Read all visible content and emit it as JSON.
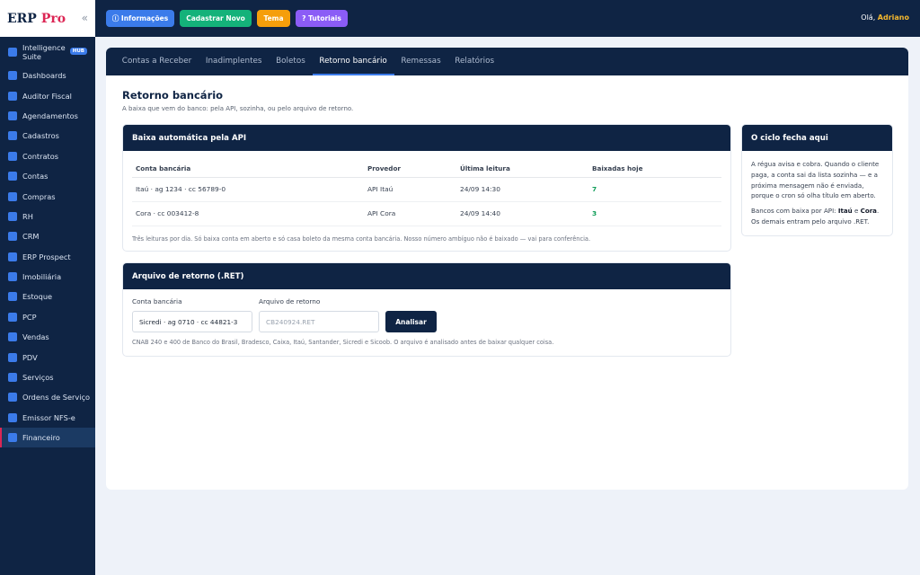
{
  "brand": {
    "erp": "ERP",
    "pro": "Pro",
    "collapse_icon": "«"
  },
  "sidebar": {
    "items": [
      {
        "label": "Intelligence Suite",
        "badge": "HUB"
      },
      {
        "label": "Dashboards"
      },
      {
        "label": "Auditor Fiscal"
      },
      {
        "label": "Agendamentos"
      },
      {
        "label": "Cadastros"
      },
      {
        "label": "Contratos"
      },
      {
        "label": "Contas"
      },
      {
        "label": "Compras"
      },
      {
        "label": "RH"
      },
      {
        "label": "CRM"
      },
      {
        "label": "ERP Prospect"
      },
      {
        "label": "Imobiliária"
      },
      {
        "label": "Estoque"
      },
      {
        "label": "PCP"
      },
      {
        "label": "Vendas"
      },
      {
        "label": "PDV"
      },
      {
        "label": "Serviços"
      },
      {
        "label": "Ordens de Serviço"
      },
      {
        "label": "Emissor NFS-e"
      },
      {
        "label": "Financeiro",
        "active": true
      }
    ]
  },
  "topbar": {
    "buttons": [
      {
        "label": "ⓘ Informações",
        "color": "#3b7bea"
      },
      {
        "label": "Cadastrar Novo",
        "color": "#14b27a"
      },
      {
        "label": "Tema",
        "color": "#f59e0b"
      },
      {
        "label": "? Tutoriais",
        "color": "#8b5cf6"
      }
    ],
    "greeting_prefix": "Olá,",
    "user_name": "Adriano"
  },
  "tabs": [
    {
      "label": "Contas a Receber"
    },
    {
      "label": "Inadimplentes"
    },
    {
      "label": "Boletos"
    },
    {
      "label": "Retorno bancário",
      "active": true
    },
    {
      "label": "Remessas"
    },
    {
      "label": "Relatórios"
    }
  ],
  "page": {
    "title": "Retorno bancário",
    "subtitle": "A baixa que vem do banco: pela API, sozinha, ou pelo arquivo de retorno."
  },
  "api_panel": {
    "title": "Baixa automática pela API",
    "columns": [
      "Conta bancária",
      "Provedor",
      "Última leitura",
      "Baixadas hoje"
    ],
    "rows": [
      [
        "Itaú · ag 1234 · cc 56789-0",
        "API Itaú",
        "24/09 14:30",
        "7"
      ],
      [
        "Cora · cc 003412-8",
        "API Cora",
        "24/09 14:40",
        "3"
      ]
    ],
    "note": "Três leituras por dia. Só baixa conta em aberto e só casa boleto da mesma conta bancária. Nosso número ambíguo não é baixado — vai para conferência."
  },
  "ret_panel": {
    "title": "Arquivo de retorno (.RET)",
    "account_label": "Conta bancária",
    "account_value": "Sicredi · ag 0710 · cc 44821-3",
    "file_label": "Arquivo de retorno",
    "file_placeholder": "CB240924.RET",
    "analyze_label": "Analisar",
    "note": "CNAB 240 e 400 de Banco do Brasil, Bradesco, Caixa, Itaú, Santander, Sicredi e Sicoob. O arquivo é analisado antes de baixar qualquer coisa."
  },
  "side_panel": {
    "title": "O ciclo fecha aqui",
    "paragraph1": "A régua avisa e cobra. Quando o cliente paga, a conta sai da lista sozinha — e a próxima mensagem não é enviada, porque o cron só olha título em aberto.",
    "p2_prefix": "Bancos com baixa por API:",
    "p2_bank1": "Itaú",
    "p2_and": "e",
    "p2_bank2": "Cora",
    "p2_suffix": ". Os demais entram pelo arquivo .RET."
  },
  "colors": {
    "navy": "#0f2444",
    "accent_blue": "#3b7bea",
    "active_marker": "#dc2654",
    "success_green": "#0f9d58",
    "greeting_name": "#f5b82e"
  }
}
